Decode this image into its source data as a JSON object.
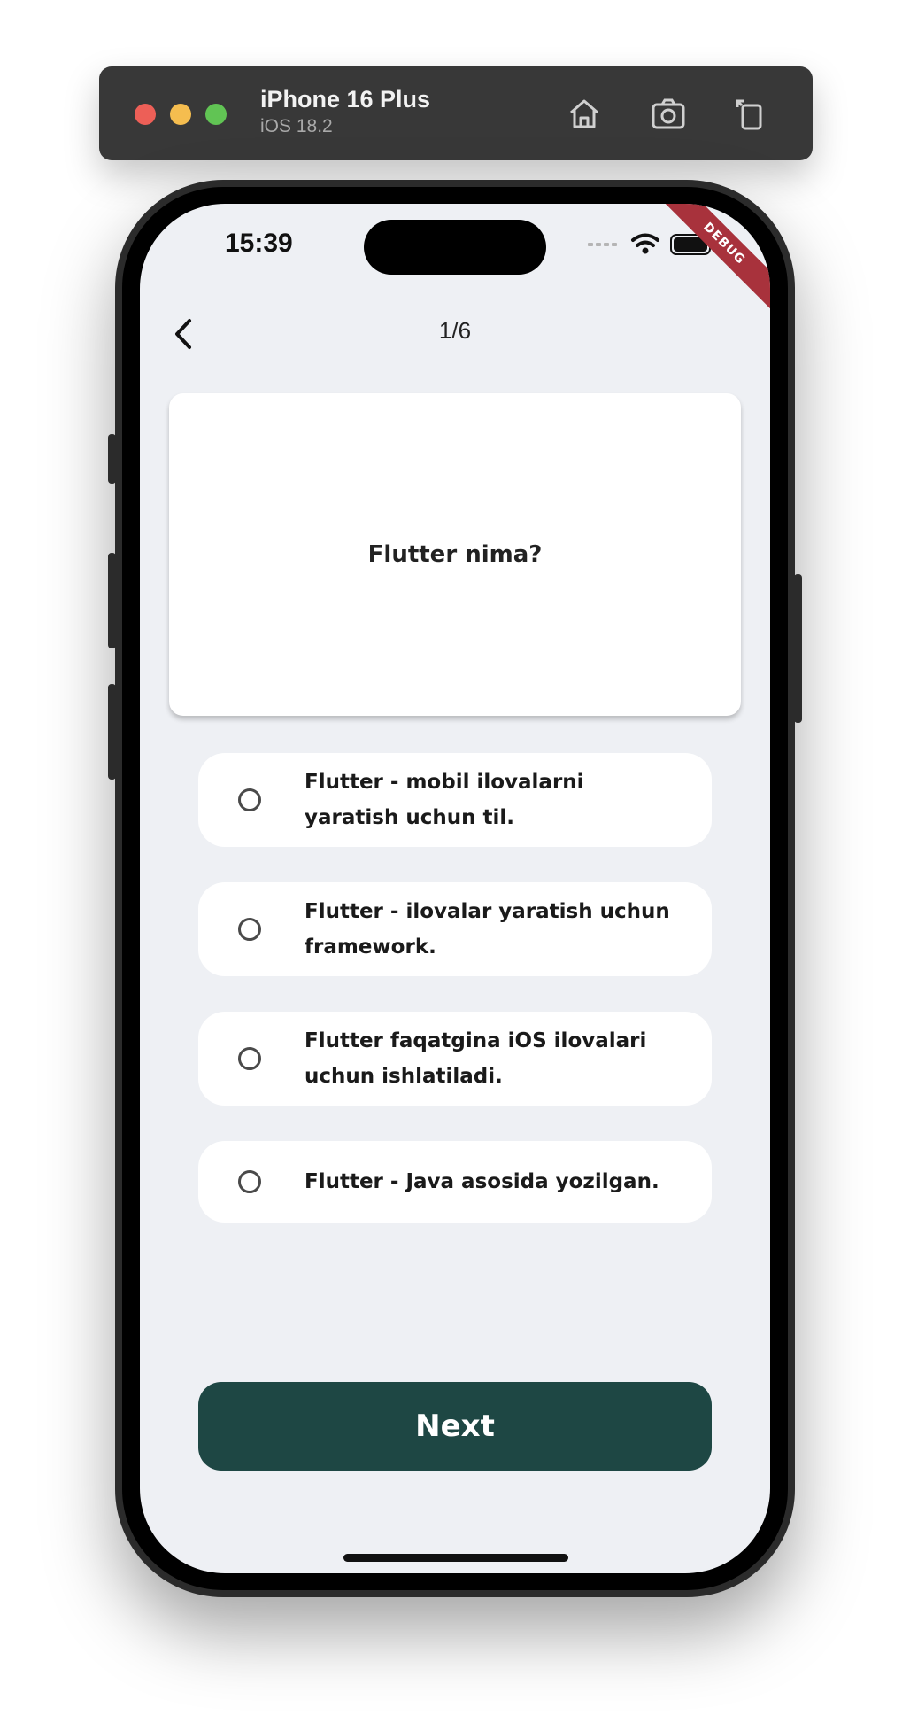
{
  "simulator": {
    "device_name": "iPhone 16 Plus",
    "os_version": "iOS 18.2",
    "icons": [
      "home-icon",
      "screenshot-icon",
      "rotate-icon"
    ]
  },
  "status_bar": {
    "time": "15:39",
    "debug_label": "DEBUG"
  },
  "header": {
    "back_icon": "chevron-left-icon",
    "progress": "1/6"
  },
  "question": {
    "text": "Flutter nima?"
  },
  "options": [
    {
      "label": "Flutter - mobil ilovalarni yaratish uchun til.",
      "selected": false
    },
    {
      "label": "Flutter - ilovalar yaratish uchun framework.",
      "selected": false
    },
    {
      "label": "Flutter faqatgina iOS ilovalari uchun ishlatiladi.",
      "selected": false
    },
    {
      "label": "Flutter - Java asosida yozilgan.",
      "selected": false
    }
  ],
  "actions": {
    "next_label": "Next"
  },
  "colors": {
    "accent": "#1e4744",
    "background": "#eef0f4",
    "debug_banner": "#a8323c"
  }
}
